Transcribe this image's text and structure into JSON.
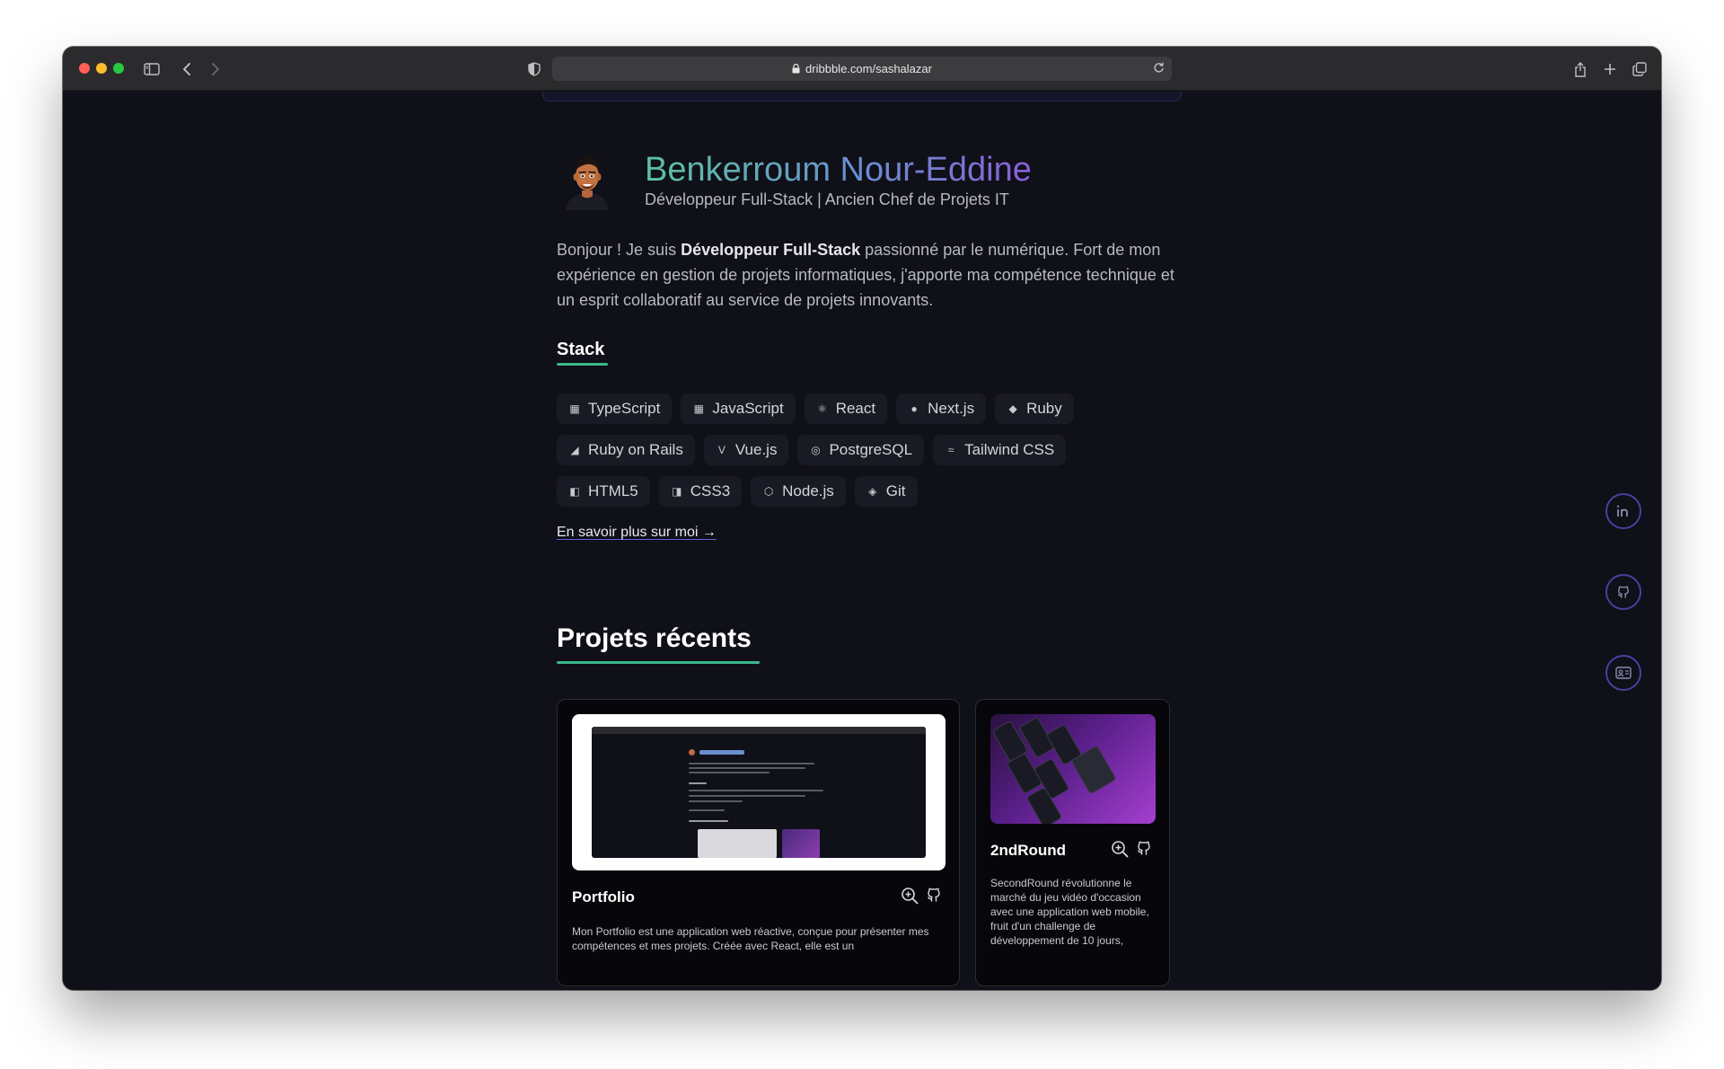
{
  "browser": {
    "url": "dribbble.com/sashalazar"
  },
  "profile": {
    "name": "Benkerroum Nour-Eddine",
    "subtitle": "Développeur Full-Stack | Ancien Chef de Projets IT",
    "intro_pre": "Bonjour ! Je suis ",
    "intro_bold": "Développeur Full-Stack",
    "intro_post": " passionné par le numérique. Fort de mon expérience en gestion de projets informatiques, j'apporte ma compétence technique et un esprit collaboratif au service de projets innovants."
  },
  "stack": {
    "title": "Stack",
    "rows": [
      [
        {
          "label": "TypeScript",
          "icon": "typescript-icon",
          "glyph": "▦"
        },
        {
          "label": "JavaScript",
          "icon": "javascript-icon",
          "glyph": "▦"
        },
        {
          "label": "React",
          "icon": "react-icon",
          "glyph": "⚛"
        },
        {
          "label": "Next.js",
          "icon": "nextjs-icon",
          "glyph": "●"
        },
        {
          "label": "Ruby",
          "icon": "ruby-icon",
          "glyph": "◆"
        }
      ],
      [
        {
          "label": "Ruby on Rails",
          "icon": "rails-icon",
          "glyph": "◢"
        },
        {
          "label": "Vue.js",
          "icon": "vue-icon",
          "glyph": "V"
        },
        {
          "label": "PostgreSQL",
          "icon": "postgresql-icon",
          "glyph": "◎"
        },
        {
          "label": "Tailwind CSS",
          "icon": "tailwind-icon",
          "glyph": "≈"
        }
      ],
      [
        {
          "label": "HTML5",
          "icon": "html5-icon",
          "glyph": "◧"
        },
        {
          "label": "CSS3",
          "icon": "css3-icon",
          "glyph": "◨"
        },
        {
          "label": "Node.js",
          "icon": "nodejs-icon",
          "glyph": "⬡"
        },
        {
          "label": "Git",
          "icon": "git-icon",
          "glyph": "◈"
        }
      ]
    ]
  },
  "more_link": "En savoir plus sur moi ",
  "more_link_arrow": "→",
  "projects": {
    "title": "Projets récents",
    "items": [
      {
        "title": "Portfolio",
        "description": "Mon Portfolio est une application web réactive, conçue pour présenter mes compétences et mes projets. Créée avec React, elle est un"
      },
      {
        "title": "2ndRound",
        "description": "SecondRound révolutionne le marché du jeu vidéo d'occasion avec une application web mobile, fruit d'un challenge de développement de 10 jours,"
      }
    ]
  },
  "social": [
    {
      "icon": "linkedin-icon"
    },
    {
      "icon": "github-icon"
    },
    {
      "icon": "id-card-icon"
    }
  ],
  "colors": {
    "background": "#0f1018",
    "accent_green": "#3bb88d",
    "accent_purple": "#8a5fd6"
  }
}
